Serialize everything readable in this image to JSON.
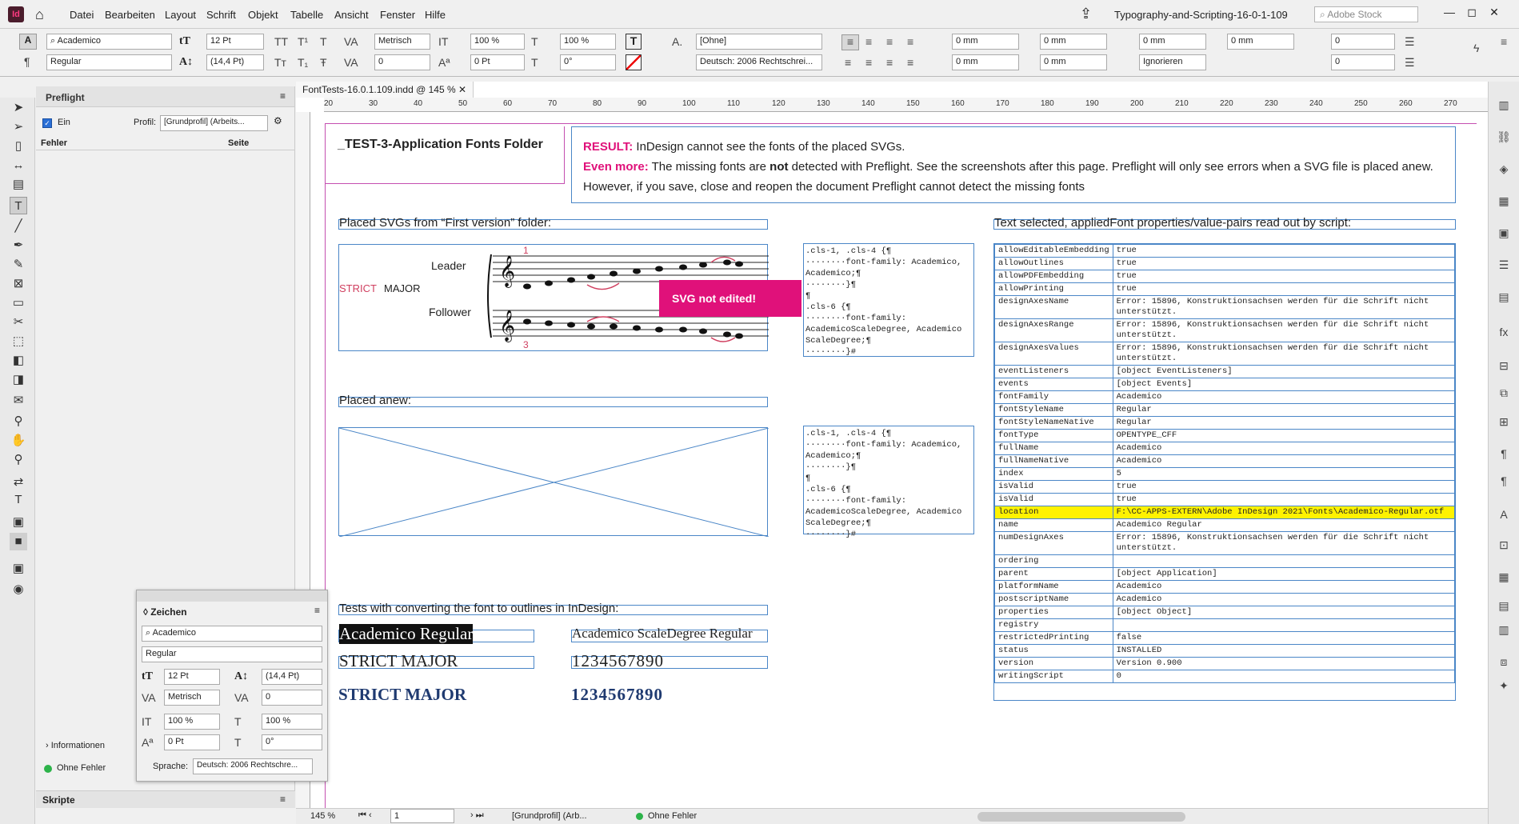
{
  "app": {
    "icon_label": "Id",
    "doc_title": "Typography-and-Scripting-16-0-1-109",
    "search_placeholder": "Adobe Stock",
    "menu": [
      "Datei",
      "Bearbeiten",
      "Layout",
      "Schrift",
      "Objekt",
      "Tabelle",
      "Ansicht",
      "Fenster",
      "Hilfe"
    ]
  },
  "control": {
    "font": "Academico",
    "style": "Regular",
    "size": "12 Pt",
    "leading": "(14,4 Pt)",
    "kerning": "Metrisch",
    "tracking": "0",
    "vscale": "100 %",
    "hscale": "100 %",
    "baseline": "0 Pt",
    "skew": "0°",
    "charstyle": "[Ohne]",
    "language": "Deutsch: 2006 Rechtschrei...",
    "indent1": "0 mm",
    "indent2": "0 mm",
    "indent3": "0 mm",
    "indent4": "0 mm",
    "space1": "0 mm",
    "space2": "0 mm",
    "dropcap1": "0",
    "dropcap2": "0",
    "ignore": "Ignorieren"
  },
  "preflight": {
    "title": "Preflight",
    "on_label": "Ein",
    "profile_label": "Profil:",
    "profile": "[Grundprofil] (Arbeits...",
    "col_errors": "Fehler",
    "col_page": "Seite",
    "info": "Informationen",
    "status": "Ohne Fehler",
    "scripts": "Skripte"
  },
  "zeichen": {
    "title": "Zeichen",
    "font": "Academico",
    "style": "Regular",
    "size": "12 Pt",
    "leading": "(14,4 Pt)",
    "kerning": "Metrisch",
    "tracking": "0",
    "vscale": "100 %",
    "hscale": "100 %",
    "baseline": "0 Pt",
    "skew": "0°",
    "lang_label": "Sprache:",
    "language": "Deutsch: 2006 Rechtschre..."
  },
  "doc": {
    "tab": "FontTests-16.0.1.109.indd @ 145 %",
    "ruler": [
      "20",
      "30",
      "40",
      "50",
      "60",
      "70",
      "80",
      "90",
      "100",
      "110",
      "120",
      "130",
      "140",
      "150",
      "160",
      "170",
      "180",
      "190",
      "200",
      "210",
      "220",
      "230",
      "240",
      "250",
      "260",
      "270"
    ],
    "heading": "_TEST-3-Application Fonts Folder",
    "result_label": "RESULT:",
    "result_text": " InDesign cannot see the fonts of the placed SVGs.",
    "more_label": "Even more:",
    "more_text1": " The missing fonts are ",
    "more_bold": "not",
    "more_text2": " detected with Preflight. See the screenshots after this page. Preflight will only see errors when a SVG file is placed anew. However, if you save, close and reopen the document Preflight cannot detect the missing fonts",
    "placed_label": "Placed SVGs from “First version” folder:",
    "placed_anew": "Placed anew:",
    "svg_tag": "SVG not edited!",
    "music": {
      "strict": "STRICT",
      "major": "MAJOR",
      "leader": "Leader",
      "follower": "Follower",
      "n1": "1",
      "n3": "3"
    },
    "css1": [
      ".cls-1, .cls-4 {¶",
      "········font-family: Academico,",
      "Academico;¶",
      "········}¶",
      "¶",
      ".cls-6 {¶",
      "········font-family:",
      "AcademicoScaleDegree, Academico",
      "ScaleDegree;¶",
      "········}#"
    ],
    "css2": [
      ".cls-1, .cls-4 {¶",
      "········font-family: Academico,",
      "Academico;¶",
      "········}¶",
      "¶",
      ".cls-6 {¶",
      "········font-family:",
      "AcademicoScaleDegree, Academico",
      "ScaleDegree;¶",
      "········}#"
    ],
    "outline_label": "Tests with converting the font to outlines in InDesign:",
    "ac_regular": "Academico Regular",
    "ac_scale": "Academico ScaleDegree Regular",
    "strict_major": "STRICT MAJOR",
    "digits": "1234567890",
    "props_label": "Text selected, appliedFont properties/value-pairs read out by script:",
    "props": [
      [
        "allowEditableEmbedding",
        "true"
      ],
      [
        "allowOutlines",
        "true"
      ],
      [
        "allowPDFEmbedding",
        "true"
      ],
      [
        "allowPrinting",
        "true"
      ],
      [
        "designAxesName",
        "Error: 15896, Konstruktionsachsen werden für die Schrift nicht unterstützt."
      ],
      [
        "designAxesRange",
        "Error: 15896, Konstruktionsachsen werden für die Schrift nicht unterstützt."
      ],
      [
        "designAxesValues",
        "Error: 15896, Konstruktionsachsen werden für die Schrift nicht unterstützt."
      ],
      [
        "eventListeners",
        "[object EventListeners]"
      ],
      [
        "events",
        "[object Events]"
      ],
      [
        "fontFamily",
        "Academico"
      ],
      [
        "fontStyleName",
        "Regular"
      ],
      [
        "fontStyleNameNative",
        "Regular"
      ],
      [
        "fontType",
        "OPENTYPE_CFF"
      ],
      [
        "fullName",
        "Academico"
      ],
      [
        "fullNameNative",
        "Academico"
      ],
      [
        "index",
        "5"
      ],
      [
        "isValid",
        "true"
      ],
      [
        "isValid",
        "true"
      ],
      [
        "location",
        "F:\\CC-APPS-EXTERN\\Adobe InDesign 2021\\Fonts\\Academico-Regular.otf"
      ],
      [
        "name",
        "Academico Regular"
      ],
      [
        "numDesignAxes",
        "Error: 15896, Konstruktionsachsen werden für die Schrift nicht unterstützt."
      ],
      [
        "ordering",
        ""
      ],
      [
        "parent",
        "[object Application]"
      ],
      [
        "platformName",
        "Academico"
      ],
      [
        "postscriptName",
        "Academico"
      ],
      [
        "properties",
        "[object Object]"
      ],
      [
        "registry",
        ""
      ],
      [
        "restrictedPrinting",
        "false"
      ],
      [
        "status",
        "INSTALLED"
      ],
      [
        "version",
        "Version 0.900"
      ],
      [
        "writingScript",
        "0"
      ]
    ]
  },
  "status": {
    "zoom": "145 %",
    "page": "1",
    "profile": "[Grundprofil] (Arb...",
    "errors": "Ohne Fehler"
  },
  "colors": {
    "magenta": "#e0117a",
    "frame": "#4a86c7",
    "highlight": "#fff200"
  }
}
